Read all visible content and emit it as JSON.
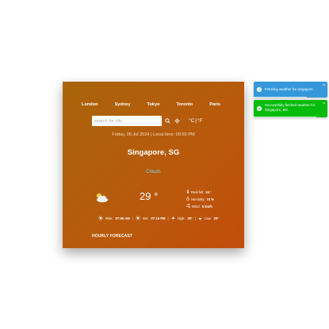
{
  "cities": [
    "London",
    "Sydney",
    "Tokyo",
    "Toronto",
    "Paris"
  ],
  "search": {
    "placeholder": "search for city..."
  },
  "units": {
    "celsius": "°C",
    "separator": "|",
    "fahrenheit": "°F"
  },
  "datetime": "Friday, 26 Jul 2024 | Local time: 09:55 PM",
  "location": "Singapore, SG",
  "condition": "Clouds",
  "temperature": "29 °",
  "details": {
    "real_feel_label": "Real fell:",
    "real_feel_value": "34 °",
    "humidity_label": "Humidity:",
    "humidity_value": "74 %",
    "wind_label": "Wind:",
    "wind_value": "5 km/h"
  },
  "summary": {
    "rise_label": "Rise:",
    "rise_value": "07:05 AM",
    "set_label": "Set:",
    "set_value": "07:16 PM",
    "high_label": "High:",
    "high_value": "30°",
    "low_label": "Low:",
    "low_value": "29°",
    "separator": "|"
  },
  "hourly_title": "HOURLY FORECAST",
  "toasts": [
    {
      "type": "info",
      "message": "Fetching weather for singapore.",
      "close": "×",
      "progress": 0.72
    },
    {
      "type": "success",
      "message": "Successfully fetched weather for Singapore, SG.",
      "close": "×",
      "progress": 0.85
    }
  ],
  "colors": {
    "card_start": "#a9640a",
    "card_end": "#c24d0c",
    "info": "#3498db",
    "success": "#07bc0c",
    "condition": "#7fd0e8"
  }
}
